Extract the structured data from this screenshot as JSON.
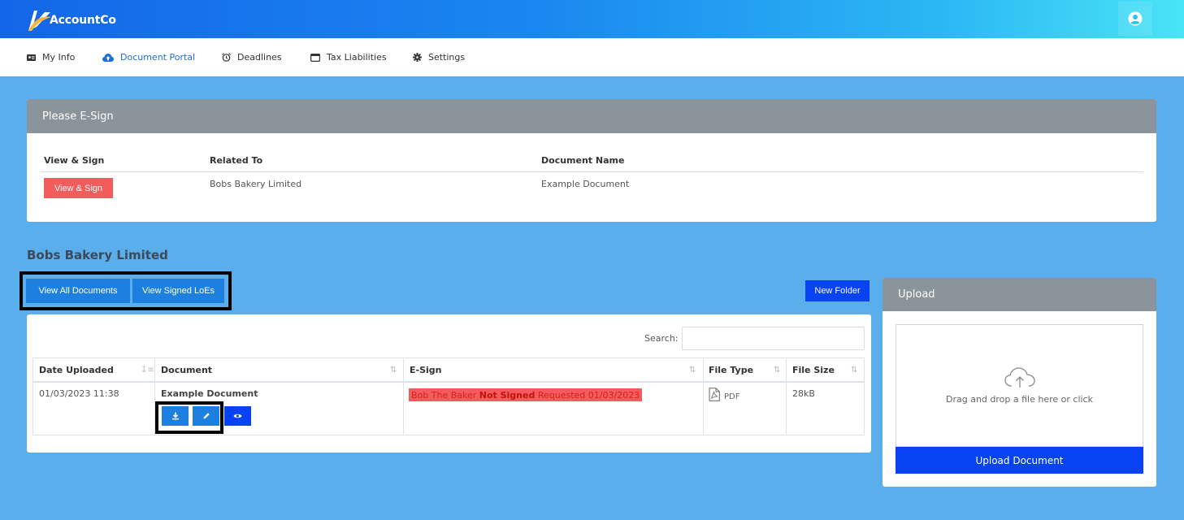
{
  "header": {
    "brand": "AccountCo"
  },
  "nav": {
    "items": [
      {
        "label": "My Info",
        "icon": "id-card-icon"
      },
      {
        "label": "Document Portal",
        "icon": "cloud-upload-icon",
        "active": true
      },
      {
        "label": "Deadlines",
        "icon": "alarm-clock-icon"
      },
      {
        "label": "Tax Liabilities",
        "icon": "window-icon"
      },
      {
        "label": "Settings",
        "icon": "gear-icon"
      }
    ]
  },
  "esign": {
    "title": "Please E-Sign",
    "columns": [
      "View & Sign",
      "Related To",
      "Document Name"
    ],
    "rows": [
      {
        "button": "View & Sign",
        "related_to": "Bobs Bakery Limited",
        "document_name": "Example Document"
      }
    ]
  },
  "documents": {
    "section_title": "Bobs Bakery Limited",
    "view_all_label": "View All Documents",
    "view_signed_label": "View Signed LoEs",
    "new_folder_label": "New Folder",
    "search_label": "Search:",
    "search_value": "",
    "columns": [
      "Date Uploaded",
      "Document",
      "E-Sign",
      "File Type",
      "File Size"
    ],
    "rows": [
      {
        "date": "01/03/2023 11:38",
        "document": "Example Document",
        "esign_name": "Bob The Baker",
        "esign_status": "Not Signed",
        "esign_requested": "Requested 01/03/2023",
        "file_type": "PDF",
        "file_size": "28kB"
      }
    ]
  },
  "upload": {
    "title": "Upload",
    "drop_text": "Drag and drop a file here or click",
    "button": "Upload Document"
  },
  "colors": {
    "background": "#5aaeec",
    "header_start": "#1466e8",
    "header_end": "#49e4f6",
    "panel_header": "#8b939b",
    "red": "#f25c5c",
    "blue": "#1d7fe0",
    "navy": "#0743f2",
    "active_nav": "#1e6fd6"
  }
}
